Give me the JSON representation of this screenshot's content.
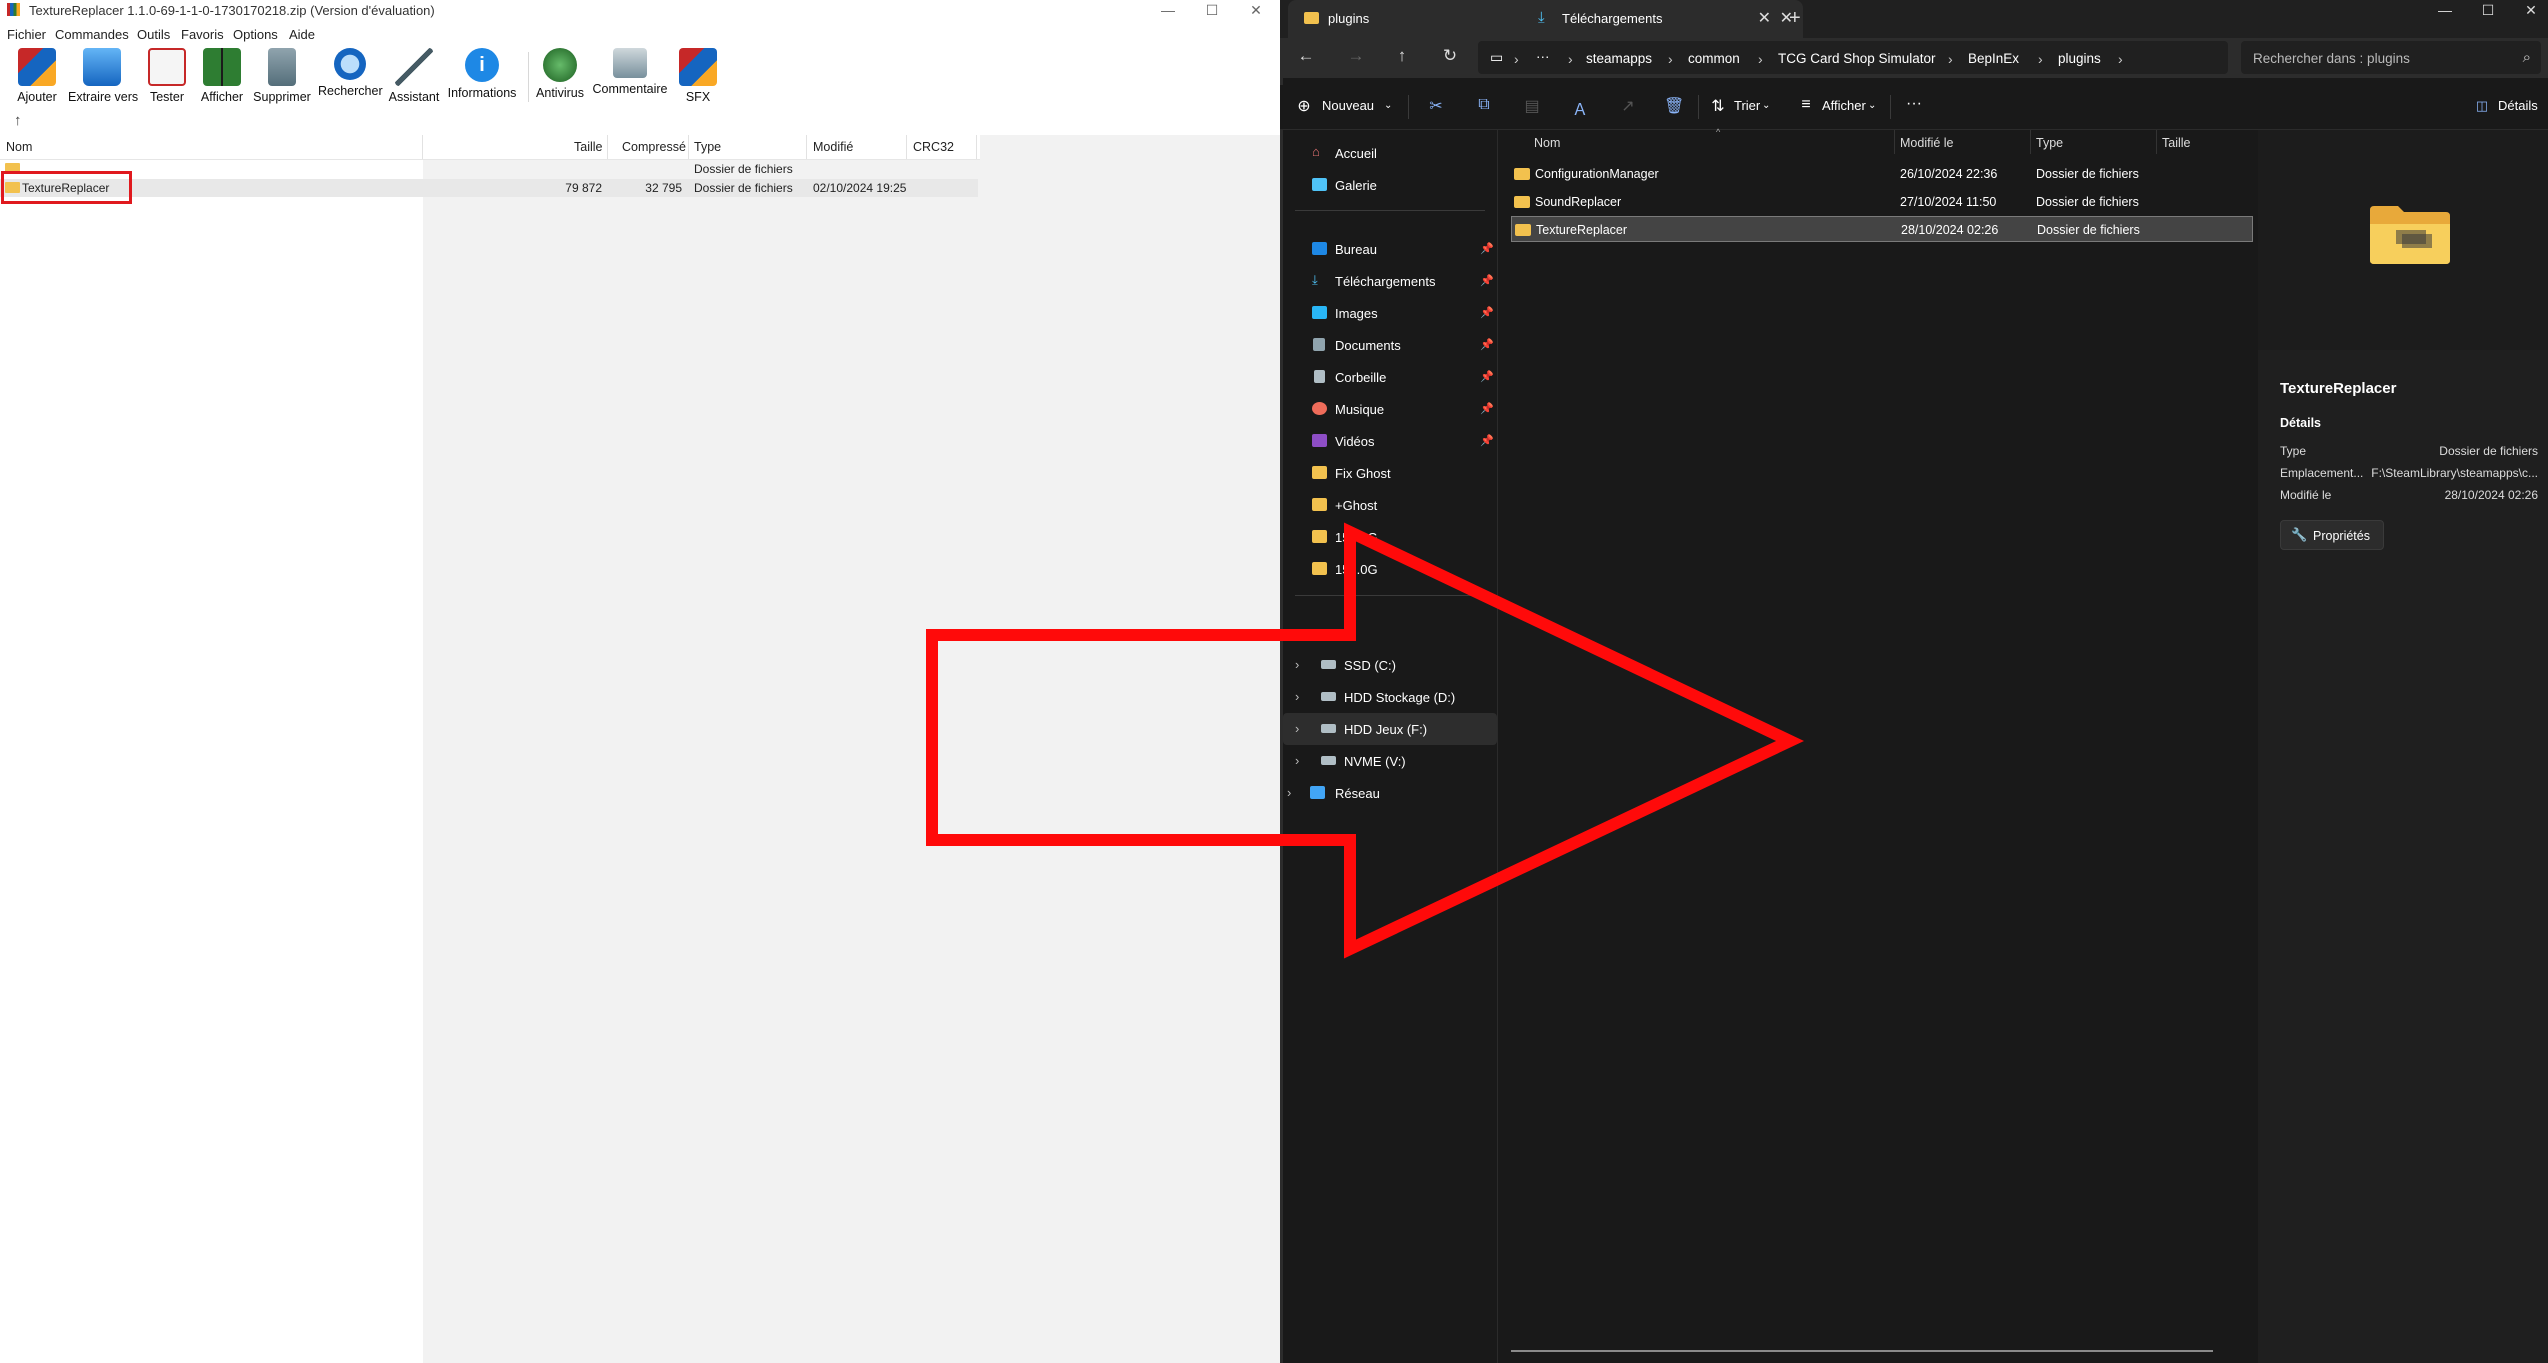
{
  "winrar": {
    "title": "TextureReplacer 1.1.0-69-1-1-0-1730170218.zip (Version d'évaluation)",
    "window_buttons": [
      "—",
      "☐",
      "✕"
    ],
    "menu": [
      "Fichier",
      "Commandes",
      "Outils",
      "Favoris",
      "Options",
      "Aide"
    ],
    "toolbar": [
      "Ajouter",
      "Extraire vers",
      "Tester",
      "Afficher",
      "Supprimer",
      "Rechercher",
      "Assistant",
      "Informations",
      "Antivirus",
      "Commentaire",
      "SFX"
    ],
    "up_arrow": "↑",
    "columns": [
      "Nom",
      "Taille",
      "Compressé",
      "Type",
      "Modifié",
      "CRC32"
    ],
    "rows": [
      {
        "name": "",
        "size": "",
        "packed": "",
        "type": "Dossier de fichiers",
        "modified": "",
        "crc": ""
      },
      {
        "name": "TextureReplacer",
        "size": "79 872",
        "packed": "32 795",
        "type": "Dossier de fichiers",
        "modified": "02/10/2024 19:25",
        "crc": ""
      }
    ]
  },
  "explorer": {
    "tabs": [
      {
        "label": "plugins",
        "close": "✕"
      },
      {
        "label": "Téléchargements",
        "close": "✕"
      }
    ],
    "add_tab": "+",
    "window_buttons": [
      "—",
      "☐",
      "✕"
    ],
    "nav_icons": [
      "←",
      "→",
      "↑",
      "↻"
    ],
    "breadcrumb": [
      "steamapps",
      "common",
      "TCG Card Shop Simulator",
      "BepInEx",
      "plugins"
    ],
    "breadcrumb_more": "···",
    "search_placeholder": "Rechercher dans : plugins",
    "commands": {
      "new": "Nouveau",
      "sort": "Trier",
      "view": "Afficher",
      "more": "···",
      "details": "Détails"
    },
    "nav_pane": {
      "quick": [
        "Accueil",
        "Galerie"
      ],
      "pinned": [
        "Bureau",
        "Téléchargements",
        "Images",
        "Documents",
        "Corbeille",
        "Musique",
        "Vidéos"
      ],
      "folders": [
        "Fix Ghost",
        "+Ghost",
        "15...0G",
        "15...0G"
      ],
      "drives": [
        "SSD (C:)",
        "HDD Stockage (D:)",
        "HDD Jeux (F:)",
        "NVME (V:)"
      ],
      "network": "Réseau"
    },
    "columns": [
      "Nom",
      "Modifié le",
      "Type",
      "Taille"
    ],
    "files": [
      {
        "name": "ConfigurationManager",
        "modified": "26/10/2024 22:36",
        "type": "Dossier de fichiers"
      },
      {
        "name": "SoundReplacer",
        "modified": "27/10/2024 11:50",
        "type": "Dossier de fichiers"
      },
      {
        "name": "TextureReplacer",
        "modified": "28/10/2024 02:26",
        "type": "Dossier de fichiers"
      }
    ],
    "details": {
      "name": "TextureReplacer",
      "section": "Détails",
      "rows": [
        {
          "k": "Type",
          "v": "Dossier de fichiers"
        },
        {
          "k": "Emplacement...",
          "v": "F:\\SteamLibrary\\steamapps\\c..."
        },
        {
          "k": "Modifié le",
          "v": "28/10/2024 02:26"
        }
      ],
      "properties": "Propriétés"
    }
  },
  "colors": {
    "highlight_red": "#e0191e",
    "folder_yellow": "#f2c14e",
    "explorer_bg": "#191919"
  }
}
